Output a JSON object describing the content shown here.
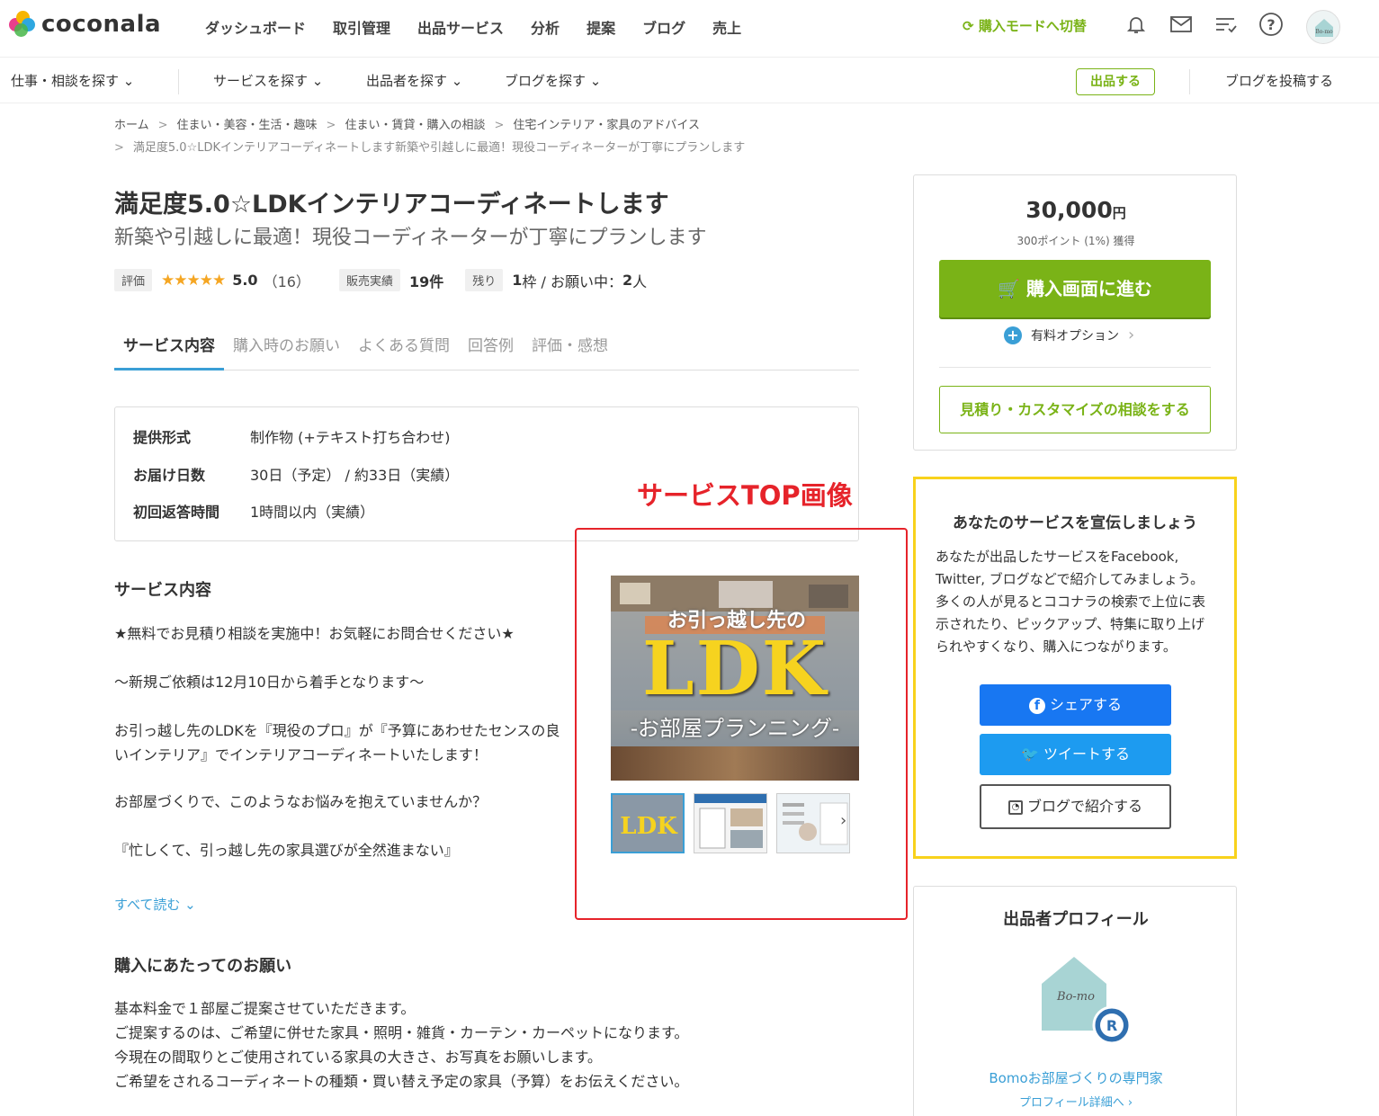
{
  "header": {
    "logo_text": "coconala",
    "nav": [
      "ダッシュボード",
      "取引管理",
      "出品サービス",
      "分析",
      "提案",
      "ブログ",
      "売上"
    ],
    "mode_switch": "購入モードへ切替",
    "icons": [
      "bell-icon",
      "mail-icon",
      "list-icon",
      "help-icon"
    ],
    "avatar_text": "Bo-mo"
  },
  "subnav": {
    "items": [
      "仕事・相談を探す",
      "サービスを探す",
      "出品者を探す",
      "ブログを探す"
    ],
    "sell_button": "出品する",
    "blog_post": "ブログを投稿する"
  },
  "breadcrumb": {
    "items": [
      "ホーム",
      "住まい・美容・生活・趣味",
      "住まい・賃貸・購入の相談",
      "住宅インテリア・家具のアドバイス"
    ],
    "current": "満足度5.0☆LDKインテリアコーディネートします新築や引越しに最適！現役コーディネーターが丁寧にプランします"
  },
  "service": {
    "title": "満足度5.0☆LDKインテリアコーディネートします",
    "subtitle": "新築や引越しに最適！現役コーディネーターが丁寧にプランします",
    "rating_label": "評価",
    "stars": "★★★★★",
    "rating": "5.0",
    "review_count": "（16）",
    "sales_label": "販売実績",
    "sales": "19件",
    "remaining_label": "残り",
    "remaining": "1",
    "remaining_unit": "枠 / お願い中：",
    "requesting": "2",
    "requesting_unit": "人"
  },
  "tabs": [
    "サービス内容",
    "購入時のお願い",
    "よくある質問",
    "回答例",
    "評価・感想"
  ],
  "spec": [
    {
      "k": "提供形式",
      "v": "制作物 (+テキスト打ち合わせ)"
    },
    {
      "k": "お届け日数",
      "v": "30日（予定） / 約33日（実績）"
    },
    {
      "k": "初回返答時間",
      "v": "1時間以内（実績）"
    }
  ],
  "content": {
    "heading": "サービス内容",
    "lines": [
      "★無料でお見積り相談を実施中！お気軽にお問合せください★",
      "〜新規ご依頼は12月10日から着手となります〜",
      "お引っ越し先のLDKを『現役のプロ』が『予算にあわせたセンスの良",
      "いインテリア』でインテリアコーディネートいたします！",
      "お部屋づくりで、このようなお悩みを抱えていませんか？",
      "『忙しくて、引っ越し先の家具選びが全然進まない』"
    ],
    "read_all": "すべて読む"
  },
  "request": {
    "heading": "購入にあたってのお願い",
    "lines": [
      "基本料金で１部屋ご提案させていただきます。",
      "ご提案するのは、ご希望に併せた家具・照明・雑貨・カーテン・カーペットになります。",
      "今現在の間取りとご使用されている家具の大きさ、お写真をお願いします。",
      "ご希望をされるコーディネートの種類・買い替え予定の家具（予算）をお伝えください。"
    ]
  },
  "annotation": {
    "label": "サービスTOP画像",
    "color": "#e6232a"
  },
  "hero": {
    "line1": "お引っ越し先の",
    "line2": "LDK",
    "line3": "-お部屋プランニング-"
  },
  "thumbs": {
    "t1": "LDK"
  },
  "purchase": {
    "price": "30,000",
    "price_unit": "円",
    "points": "300ポイント (1%) 獲得",
    "buy_button": "購入画面に進む",
    "option": "有料オプション",
    "estimate_button": "見積り・カスタマイズの相談をする"
  },
  "promo": {
    "heading": "あなたのサービスを宣伝しましょう",
    "lines": [
      "あなたが出品したサービスをFacebook,",
      "Twitter, ブログなどで紹介してみましょう。",
      "多くの人が見るとココナラの検索で上位に表",
      "示されたり、ピックアップ、特集に取り上げ",
      "られやすくなり、購入につながります。"
    ],
    "facebook": "シェアする",
    "twitter": "ツイートする",
    "blog": "ブログで紹介する"
  },
  "profile": {
    "heading": "出品者プロフィール",
    "logo_text": "Bo-mo",
    "name": "Bomoお部屋づくりの専門家",
    "link": "プロフィール詳細へ"
  },
  "colors": {
    "brand_green": "#7ab317",
    "link_blue": "#3a9fd6",
    "promo_yellow": "#f8d21c",
    "facebook": "#1877f2",
    "twitter": "#1d9bf0"
  }
}
